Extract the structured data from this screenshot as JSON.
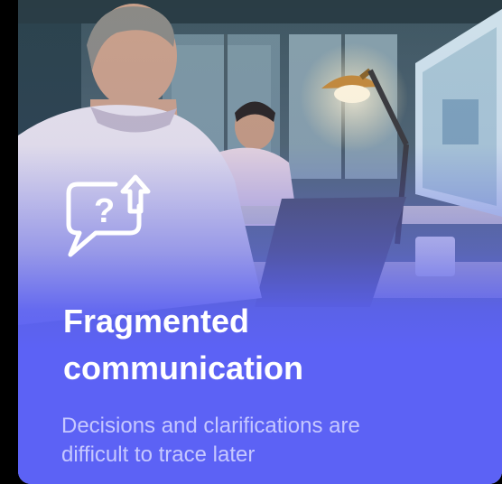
{
  "card": {
    "icon": "chat-question-upload-icon",
    "title_line1": "Fragmented",
    "title_line2": "communication",
    "description_line1": "Decisions and clarifications are",
    "description_line2": "difficult to trace later",
    "accent_color": "#5c62f5",
    "title_color": "#ffffff",
    "description_color": "#c6c8ff"
  }
}
